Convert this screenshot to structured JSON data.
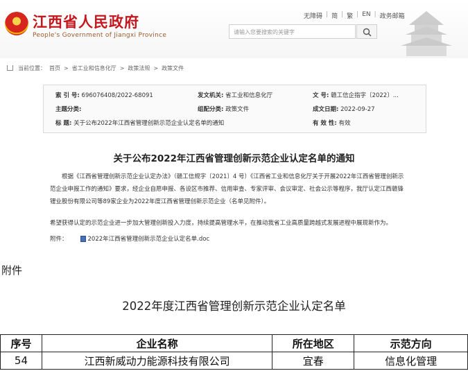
{
  "header": {
    "title": "江西省人民政府",
    "subtitle": "People's Government of Jiangxi Province",
    "links": [
      "无障碍",
      "简",
      "繁",
      "EN",
      "政务邮箱"
    ],
    "search_placeholder": "请输入您要搜索的关键字"
  },
  "breadcrumb": {
    "label": "当前位置：",
    "items": [
      "首页",
      "省工业和信息化厅",
      "政策法规",
      "政策文件"
    ],
    "sep": ">"
  },
  "meta": {
    "index_label": "索 引 号:",
    "index_value": "696076408/2022-68091",
    "issuer_label": "发文机关:",
    "issuer_value": "省工业和信息化厅",
    "docno_label": "文  号:",
    "docno_value": "赣工信企指字〔2022〕...",
    "topic_label": "主题分类:",
    "topic_value": "",
    "genre_label": "组配分类:",
    "genre_value": "政策文件",
    "date_label": "成文日期:",
    "date_value": "2022-09-27",
    "subject_label": "标    题:",
    "subject_value": "关于公布2022年江西省管理创新示范企业认定名单的通知",
    "valid_label": "有 效 性:",
    "valid_value": "有效"
  },
  "article": {
    "title": "关于公布2022年江西省管理创新示范企业认定名单的通知",
    "para1_line1": "根据《江西省管理创新示范企业认定办法》（赣工信规字〔2021〕4 号）《江西省工业和信息化厅关于开展2022年江西省管理创新示",
    "para1_line2": "范企业申报工作的通知》要求，经企业自愿申报、各设区市推荐、信用审查、专家评审、会议审定、社会公示等程序，我厅认定江西赣锋",
    "para1_line3": "锂业股份有限公司等89家企业为2022年度江西省管理创新示范企业（名单见附件）。",
    "para2": "希望获得认定的示范企业进一步加大管理创新投入力度，持续提高管理水平，在推动我省工业高质量跨越式发展进程中展现新作为。",
    "attach_label": "附件：",
    "attach_file": "2022年江西省管理创新示范企业认定名单.doc"
  },
  "appendix": {
    "label": "附件",
    "list_title": "2022年度江西省管理创新示范企业认定名单",
    "headers": [
      "序号",
      "企业名称",
      "所在地区",
      "示范方向"
    ],
    "rows": [
      [
        "54",
        "江西新威动力能源科技有限公司",
        "宜春",
        "信息化管理"
      ]
    ]
  }
}
